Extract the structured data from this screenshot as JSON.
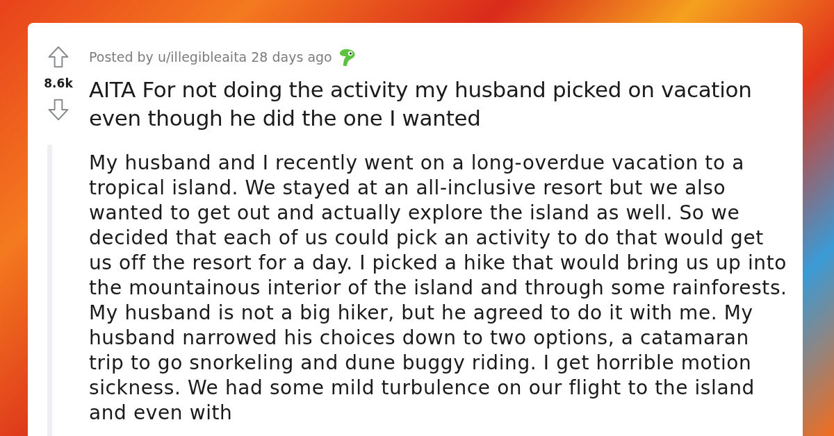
{
  "post": {
    "votes": "8.6k",
    "meta": "Posted by u/illegibleaita 28 days ago",
    "title": "AITA For not doing the activity my husband picked on vacation even though he did the one I wanted",
    "body": "My husband and I recently went on a long-overdue vacation to a tropical island. We stayed at an all-inclusive resort but we also wanted to get out and actually explore the island as well. So we decided that each of us could pick an activity to do that would get us off the resort for a day. I picked a hike that would bring us up into the mountainous interior of the island and through some rainforests. My husband is not a big hiker, but he agreed to do it with me. My husband narrowed his choices down to two options, a catamaran trip to go snorkeling and dune buggy riding. I get horrible motion sickness. We had some mild turbulence on our flight to the island and even with"
  }
}
